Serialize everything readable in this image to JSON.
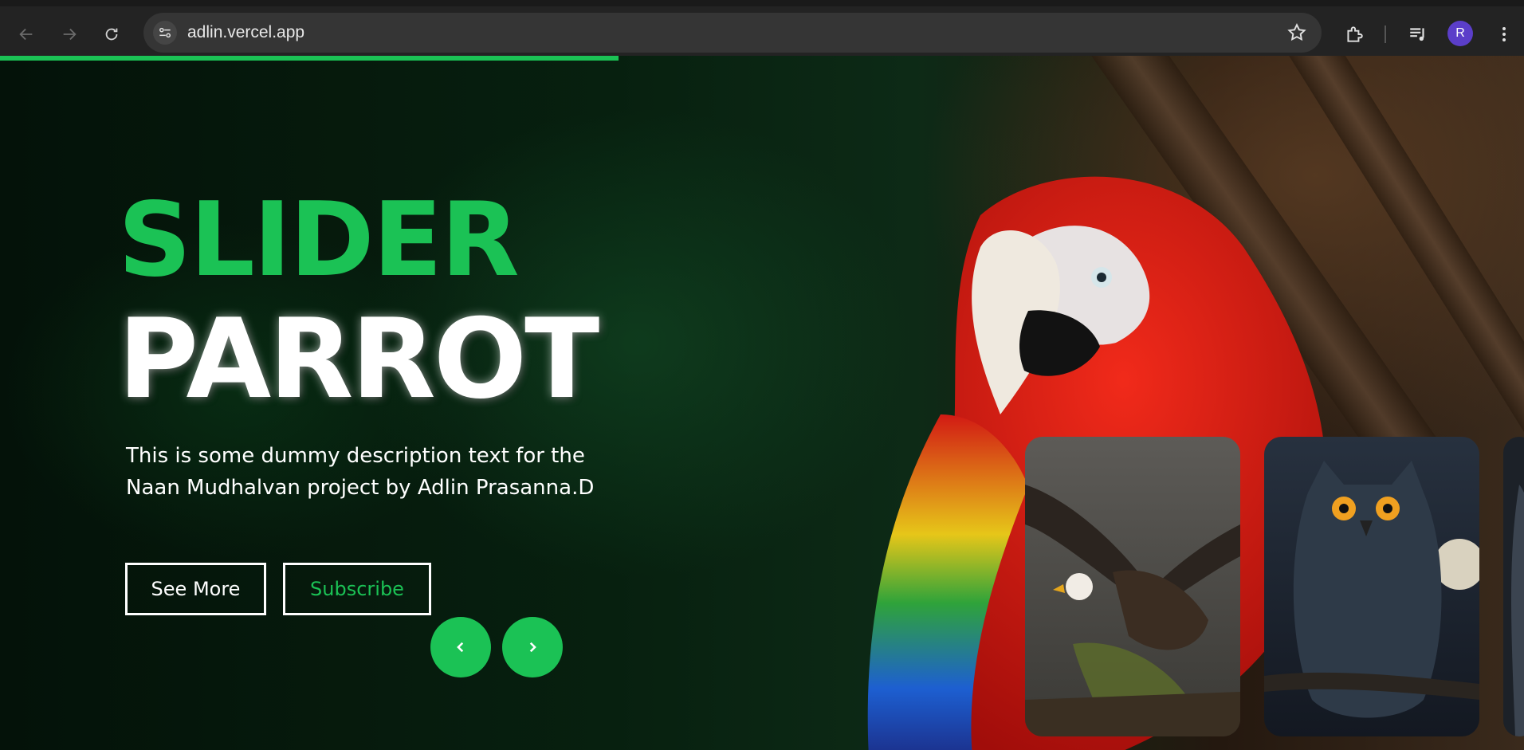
{
  "browser": {
    "url": "adlin.vercel.app",
    "avatar_letter": "R",
    "load_progress_percent": 40.6
  },
  "hero": {
    "title_line1": "SLIDER",
    "title_line2": "PARROT",
    "description": "This is some dummy description text for the Naan Mudhalvan project by Adlin Prasanna.D",
    "see_more_label": "See More",
    "subscribe_label": "Subscribe"
  },
  "colors": {
    "accent": "#1bc255",
    "chrome_bg": "#232323",
    "omnibox_bg": "#353535",
    "avatar_bg": "#5b3ec9"
  },
  "thumbnails": [
    {
      "subject": "eagle"
    },
    {
      "subject": "owl"
    },
    {
      "subject": "partial-bird"
    }
  ]
}
